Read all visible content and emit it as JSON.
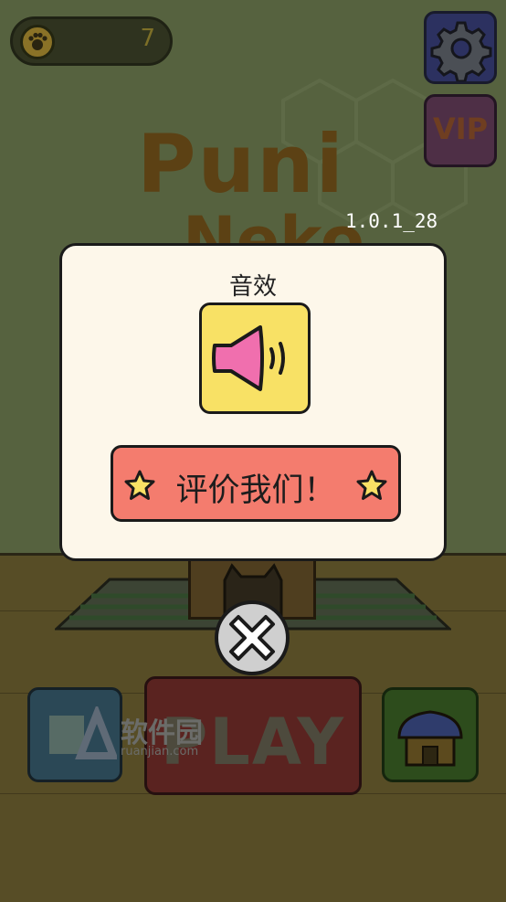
{
  "hud": {
    "coin_count": "7"
  },
  "game_title": {
    "line1": "Puni",
    "line2": "Neko"
  },
  "version": "1.0.1_28",
  "buttons": {
    "vip_label": "VIP",
    "play_label": "PLAY"
  },
  "dialog": {
    "title": "音效",
    "sound_state": "on",
    "rate_label": "评价我们！"
  },
  "watermark": {
    "text": "软件园",
    "sub": "ruanjian.com"
  },
  "colors": {
    "dialog_bg": "#fdf7ea",
    "sound_button": "#f8e165",
    "rate_button": "#f47c6e",
    "speaker": "#f06fae",
    "star": "#f8e165"
  }
}
